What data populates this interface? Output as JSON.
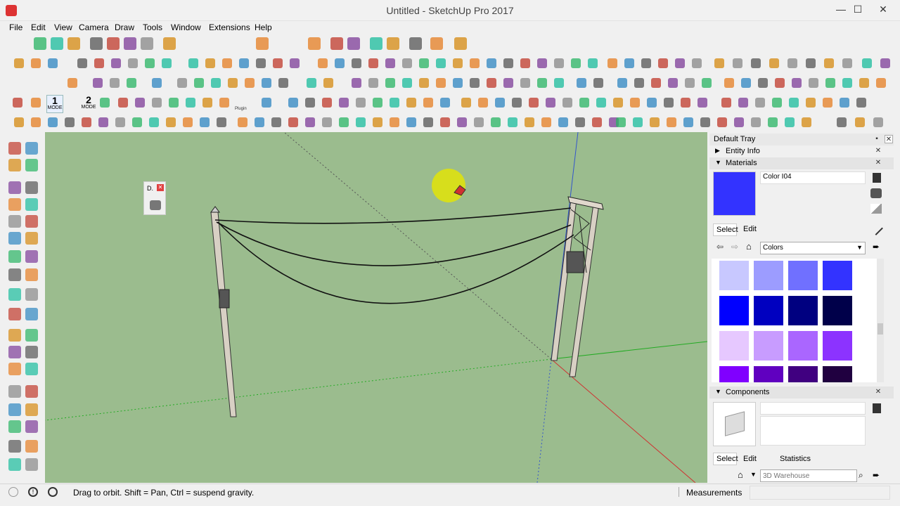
{
  "window": {
    "title": "Untitled - SketchUp Pro 2017",
    "minimize": "—",
    "maximize": "☐",
    "close": "✕"
  },
  "menu": [
    "File",
    "Edit",
    "View",
    "Camera",
    "Draw",
    "Tools",
    "Window",
    "Extensions",
    "Help"
  ],
  "toolbar": {
    "mode1_number": "1",
    "mode1_label": "MODE",
    "mode2_number": "2",
    "mode2_label": "MODE",
    "plugin_label": "Plugin"
  },
  "float_panel": {
    "label": "D.",
    "close": "✕"
  },
  "tray": {
    "title": "Default Tray",
    "entity_info": "Entity Info",
    "materials": "Materials",
    "material_name": "Color I04",
    "material_color": "#3333ff",
    "select_tab": "Select",
    "edit_tab": "Edit",
    "library": "Colors",
    "components": "Components",
    "comp_select_tab": "Select",
    "comp_edit_tab": "Edit",
    "comp_stats_tab": "Statistics",
    "search_placeholder": "3D Warehouse",
    "swatches": [
      "#c8c8ff",
      "#9c9cff",
      "#7070ff",
      "#3333ff",
      "#0000ff",
      "#0000c0",
      "#000080",
      "#00004a",
      "#e6c8ff",
      "#c89cff",
      "#aa66ff",
      "#8c33ff",
      "#8000ff",
      "#6000c0",
      "#400080",
      "#200040"
    ]
  },
  "status": {
    "hint": "Drag to orbit. Shift = Pan, Ctrl = suspend gravity.",
    "measurements_label": "Measurements",
    "measurements_value": ""
  },
  "colors": {
    "viewport_bg": "#9bbc8e",
    "axis_red": "#d03030",
    "axis_green": "#22aa22",
    "axis_blue": "#3355cc",
    "cursor_highlight": "#e6e600"
  }
}
